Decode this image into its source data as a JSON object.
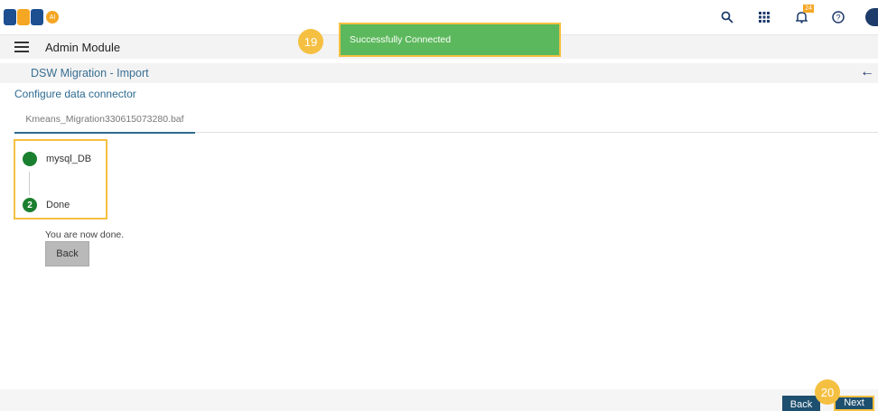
{
  "header": {
    "logo_text": "BDB",
    "logo_badge": "AI",
    "icons": [
      "search-icon",
      "apps-grid-icon",
      "bell-icon",
      "help-icon"
    ],
    "notification_count": "24"
  },
  "module": {
    "title": "Admin Module"
  },
  "page": {
    "title": "DSW Migration - Import"
  },
  "configure": {
    "label": "Configure data connector"
  },
  "file_tab": {
    "label": "Kmeans_Migration330615073280.baf"
  },
  "steps": [
    {
      "number": "",
      "label": "mysql_DB"
    },
    {
      "number": "2",
      "label": "Done"
    }
  ],
  "done": {
    "message": "You are now done.",
    "back_label": "Back"
  },
  "footer": {
    "back_label": "Back",
    "next_label": "Next"
  },
  "toast": {
    "message": "Successfully Connected"
  },
  "callouts": {
    "first": "19",
    "second": "20"
  },
  "colors": {
    "accent": "#1d4f6f",
    "success": "#5cb85c",
    "highlight": "#f5c042",
    "step_green": "#1a7f2e",
    "link": "#2d6a8f"
  }
}
